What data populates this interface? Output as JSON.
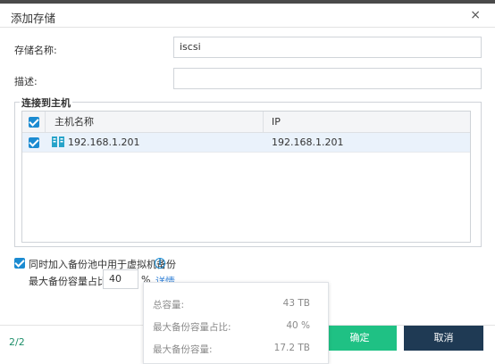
{
  "dialog": {
    "title": "添加存储",
    "close_glyph": "×"
  },
  "form": {
    "name_label": "存储名称:",
    "name_value": "iscsi",
    "desc_label": "描述:",
    "desc_value": ""
  },
  "hosts": {
    "legend": "连接到主机",
    "columns": [
      "主机名称",
      "IP"
    ],
    "rows": [
      {
        "name": "192.168.1.201",
        "ip": "192.168.1.201",
        "checked": true
      }
    ]
  },
  "backup": {
    "checkbox_label": "同时加入备份池中用于虚拟机备份",
    "info_glyph": "i",
    "ratio_label": "最大备份容量占比:",
    "ratio_value": "40",
    "percent_sign": "%",
    "details_link": "详情"
  },
  "popup": {
    "total_label": "总容量:",
    "total_value": "43 TB",
    "ratio_label": "最大备份容量占比:",
    "ratio_value": "40 %",
    "capacity_label": "最大备份容量:",
    "capacity_value": "17.2 TB"
  },
  "footer": {
    "page_indicator": "2/2",
    "confirm_label": "确定",
    "cancel_label": "取消"
  },
  "colors": {
    "accent": "#1b8bd1",
    "confirm": "#1fc184",
    "cancel": "#1f3a54",
    "link": "#2f7fd6"
  }
}
